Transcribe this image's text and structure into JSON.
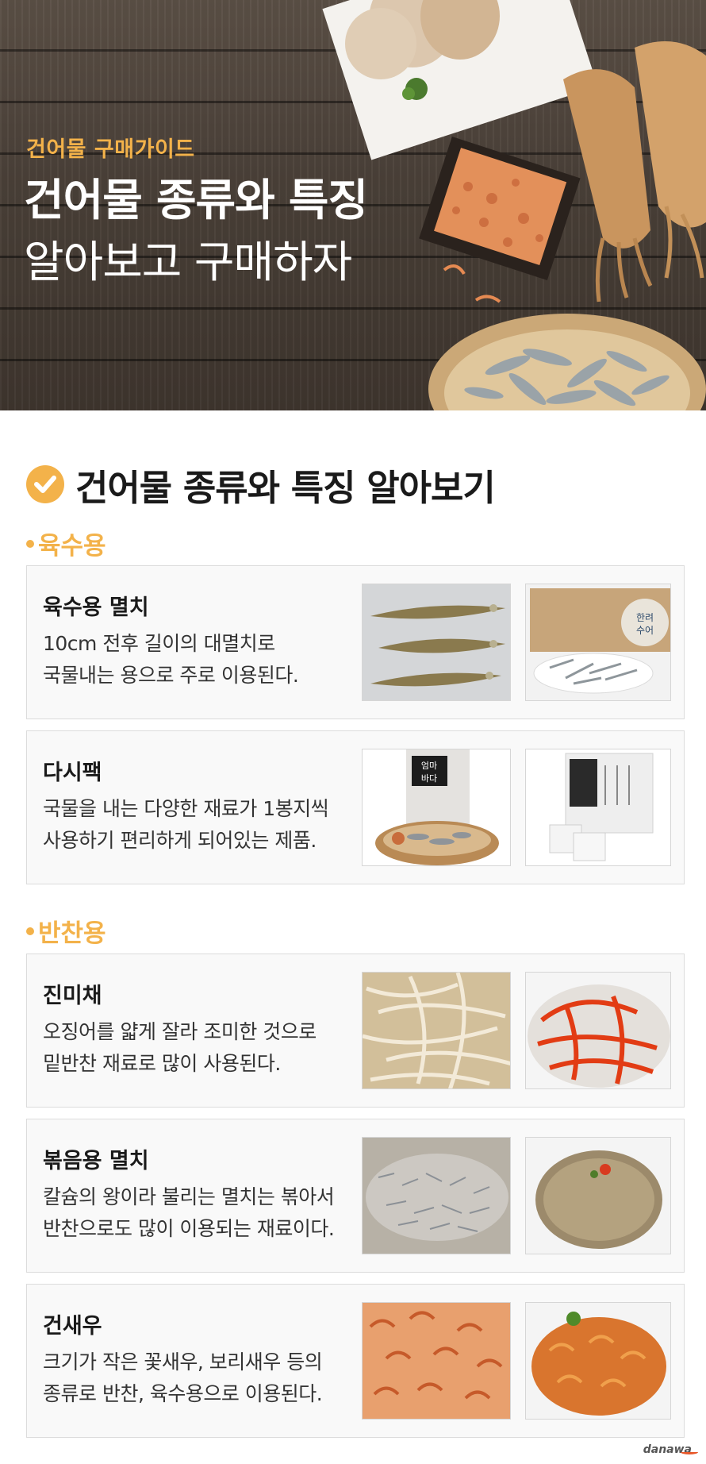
{
  "hero": {
    "subtitle": "건어물 구매가이드",
    "title_line1": "건어물 종류와 특징",
    "title_line2": "알아보고 구매하자"
  },
  "section": {
    "title": "건어물 종류와 특징 알아보기"
  },
  "categories": [
    {
      "label": "육수용",
      "items": [
        {
          "name": "육수용 멸치",
          "desc_line1": "10cm 전후 길이의 대멸치로",
          "desc_line2": "국물내는 용으로 주로 이용된다.",
          "image_a": "large-anchovy-photo",
          "image_b": "anchovy-box-photo"
        },
        {
          "name": "다시팩",
          "desc_line1": "국물을 내는 다양한 재료가 1봉지씩",
          "desc_line2": "사용하기 편리하게 되어있는 제품.",
          "image_a": "dashi-pack-bag-photo",
          "image_b": "dashi-pack-sachet-photo",
          "pack_label_a": "엄마\n바다",
          "pack_label_b": "한려수어"
        }
      ]
    },
    {
      "label": "반찬용",
      "items": [
        {
          "name": "진미채",
          "desc_line1": "오징어를 얇게 잘라 조미한 것으로",
          "desc_line2": "밑반찬 재료로 많이 사용된다.",
          "image_a": "dried-squid-strips-photo",
          "image_b": "seasoned-squid-photo"
        },
        {
          "name": "볶음용 멸치",
          "desc_line1": "칼슘의 왕이라 불리는 멸치는 볶아서",
          "desc_line2": "반찬으로도 많이 이용되는 재료이다.",
          "image_a": "small-anchovy-photo",
          "image_b": "stir-fried-anchovy-photo"
        },
        {
          "name": "건새우",
          "desc_line1": "크기가 작은 꽃새우, 보리새우 등의",
          "desc_line2": "종류로 반찬, 육수용으로 이용된다.",
          "image_a": "dried-shrimp-photo",
          "image_b": "stir-fried-shrimp-photo"
        }
      ]
    }
  ],
  "footer": {
    "logo": "danawa"
  },
  "colors": {
    "accent": "#f3b24a",
    "card_bg": "#f9f9f9",
    "card_border": "#dcdcdc"
  }
}
